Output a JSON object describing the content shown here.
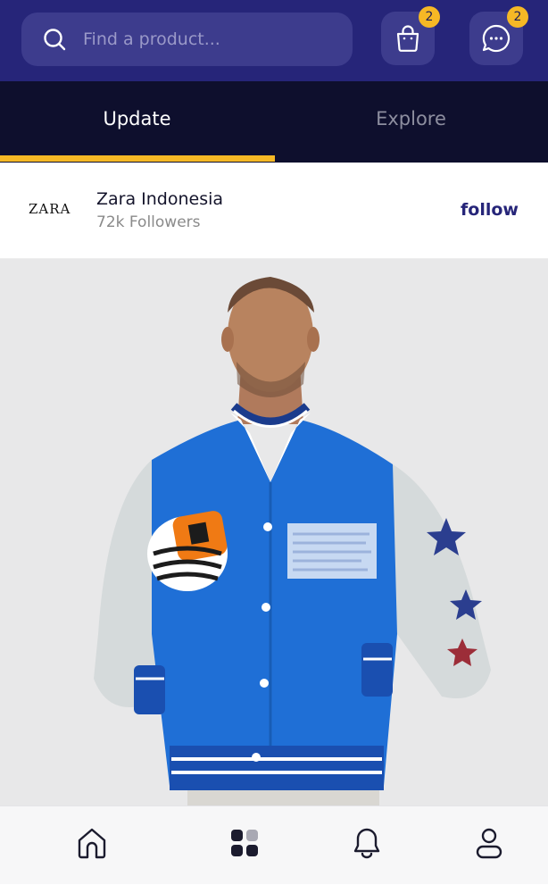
{
  "search": {
    "placeholder": "Find a product...",
    "icon": "search-icon"
  },
  "header": {
    "cart": {
      "icon": "shopping-bag-icon",
      "badge": "2"
    },
    "messages": {
      "icon": "chat-bubble-icon",
      "badge": "2"
    }
  },
  "tabs": [
    {
      "label": "Update",
      "active": true
    },
    {
      "label": "Explore",
      "active": false
    }
  ],
  "store": {
    "logo_text": "ZARA",
    "name": "Zara Indonesia",
    "followers": "72k Followers",
    "follow_label": "follow"
  },
  "post": {
    "image": "man-wearing-blue-varsity-jacket-photo"
  },
  "bottom_nav": [
    {
      "name": "home",
      "icon": "home-icon"
    },
    {
      "name": "categories",
      "icon": "grid-icon"
    },
    {
      "name": "notifications",
      "icon": "bell-icon"
    },
    {
      "name": "profile",
      "icon": "user-icon"
    }
  ],
  "colors": {
    "header_bg": "#262579",
    "tabs_bg": "#0e0f2d",
    "accent": "#f6b825",
    "follow_text": "#262579"
  }
}
